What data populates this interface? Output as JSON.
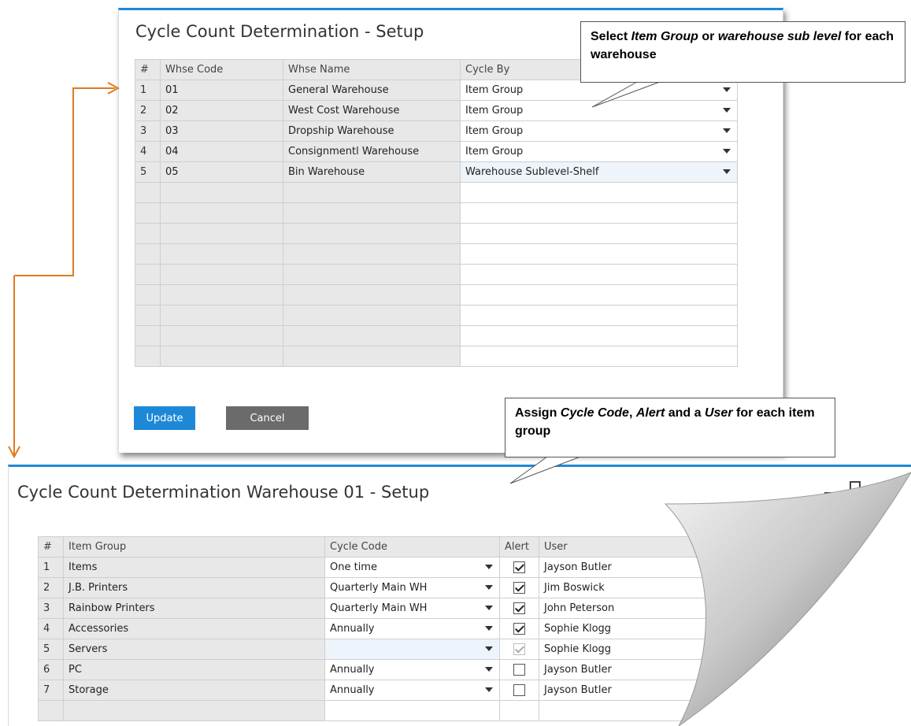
{
  "top_window": {
    "title": "Cycle Count Determination - Setup",
    "columns": [
      "#",
      "Whse Code",
      "Whse Name",
      "Cycle By"
    ],
    "rows": [
      {
        "num": "1",
        "code": "01",
        "name": "General Warehouse",
        "cycle_by": "Item Group"
      },
      {
        "num": "2",
        "code": "02",
        "name": "West Cost Warehouse",
        "cycle_by": "Item Group"
      },
      {
        "num": "3",
        "code": "03",
        "name": "Dropship Warehouse",
        "cycle_by": "Item Group"
      },
      {
        "num": "4",
        "code": "04",
        "name": "Consignmentl Warehouse",
        "cycle_by": "Item Group"
      },
      {
        "num": "5",
        "code": "05",
        "name": "Bin Warehouse",
        "cycle_by": "Warehouse Sublevel-Shelf"
      }
    ],
    "update_label": "Update",
    "cancel_label": "Cancel"
  },
  "bottom_window": {
    "title": "Cycle Count Determination Warehouse 01 - Setup",
    "columns": [
      "#",
      "Item Group",
      "Cycle Code",
      "Alert",
      "User"
    ],
    "rows": [
      {
        "num": "1",
        "group": "Items",
        "cycle_code": "One time",
        "alert": true,
        "user": "Jayson Butler"
      },
      {
        "num": "2",
        "group": "J.B. Printers",
        "cycle_code": "Quarterly Main WH",
        "alert": true,
        "user": "Jim Boswick"
      },
      {
        "num": "3",
        "group": "Rainbow Printers",
        "cycle_code": "Quarterly Main WH",
        "alert": true,
        "user": "John Peterson"
      },
      {
        "num": "4",
        "group": "Accessories",
        "cycle_code": "Annually",
        "alert": true,
        "user": "Sophie Klogg"
      },
      {
        "num": "5",
        "group": "Servers",
        "cycle_code": "",
        "alert": "disabled",
        "user": "Sophie Klogg"
      },
      {
        "num": "6",
        "group": "PC",
        "cycle_code": "Annually",
        "alert": false,
        "user": "Jayson Butler"
      },
      {
        "num": "7",
        "group": "Storage",
        "cycle_code": "Annually",
        "alert": false,
        "user": "Jayson Butler"
      }
    ]
  },
  "callout_top": {
    "part1": "Select ",
    "part2": "Item Group",
    "part3": " or ",
    "part4": "warehouse sub level",
    "part5": " for each warehouse"
  },
  "callout_bottom": {
    "part1": "Assign ",
    "part2": "Cycle Code",
    "part3": ", ",
    "part4": "Alert",
    "part5": " and a ",
    "part6": "User",
    "part7": " for each item group"
  },
  "colors": {
    "accent_blue": "#1e88d8",
    "update_button": "#1e88d8",
    "cancel_button": "#6b6b6b",
    "connector_orange": "#e07b1f"
  },
  "icons": {
    "dropdown": "caret-down",
    "checkbox": "checkmark",
    "window_controls": [
      "minimize",
      "maximize",
      "close"
    ]
  }
}
